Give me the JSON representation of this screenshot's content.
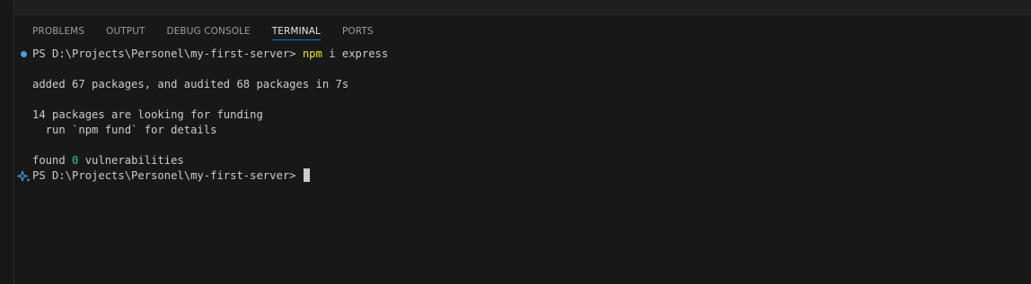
{
  "panel": {
    "tabs": [
      {
        "label": "PROBLEMS"
      },
      {
        "label": "OUTPUT"
      },
      {
        "label": "DEBUG CONSOLE"
      },
      {
        "label": "TERMINAL"
      },
      {
        "label": "PORTS"
      }
    ],
    "active_tab": "TERMINAL"
  },
  "terminal": {
    "prompt": "PS D:\\Projects\\Personel\\my-first-server> ",
    "command_name": "npm",
    "command_args": " i express",
    "output": {
      "added_line": "added 67 packages, and audited 68 packages in 7s",
      "funding_line": "14 packages are looking for funding",
      "fund_hint": "  run `npm fund` for details",
      "found_prefix": "found ",
      "found_count": "0",
      "found_suffix": " vulnerabilities"
    },
    "prompt2": "PS D:\\Projects\\Personel\\my-first-server> "
  },
  "colors": {
    "command": "#e5e510",
    "success_count": "#23d18b",
    "decoration_dot": "#4a9edb",
    "accent": "#0078d4"
  },
  "icons": {
    "command_decoration": "circle-dot-icon",
    "new_prompt_decoration": "sparkle-icon"
  }
}
